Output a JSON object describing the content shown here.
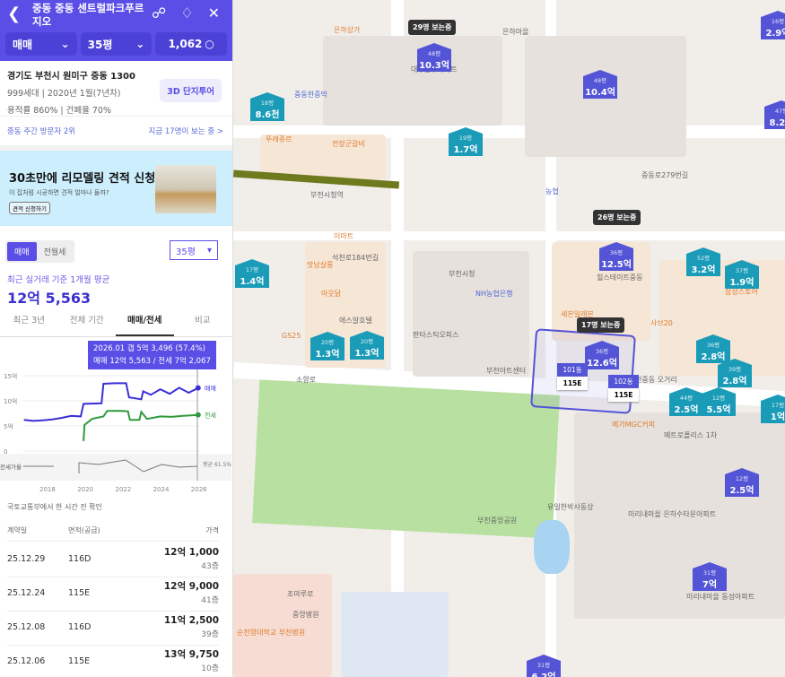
{
  "header": {
    "title": "중동 중동 센트럴파크푸르지오",
    "filters": [
      "매매",
      "35평",
      "1,062"
    ]
  },
  "info": {
    "address": "경기도 부천시 원미구 중동 1300",
    "line1": "999세대 | 2020년 1월(7년차)",
    "line2": "용적률 860% | 건폐율 70%",
    "tour": "3D 단지투어"
  },
  "visit": {
    "rank": "중동 주간 방문자 2위",
    "now": "지금 17명이 보는 중 >"
  },
  "ad": {
    "title": "30초만에 리모델링 견적 신청",
    "sub": "이 집처럼 시공하면 견적 얼마나 들까?",
    "button": "견적 신청하기"
  },
  "price": {
    "toggle": [
      "매매",
      "전월세"
    ],
    "size": "35평",
    "avg_label": "최근 실거래 기준 1개월 평균",
    "avg": "12억 5,563",
    "tabs": [
      "최근 3년",
      "전체 기간",
      "매매/전세",
      "비교"
    ],
    "tooltip1": "2026.01  갭 5억 3,496 (57.4%)",
    "tooltip2": "매매 12억 5,563 / 전세 7억 2,067"
  },
  "chart_data": {
    "type": "line",
    "xlim": [
      2016.8,
      2026.3
    ],
    "ylim": [
      0,
      15
    ],
    "yticks": [
      "15억",
      "10억",
      "5억",
      "0"
    ],
    "yvals": [
      15,
      10,
      5,
      0
    ],
    "xticks": [
      "2018",
      "2020",
      "2022",
      "2024",
      "2026"
    ],
    "xvals": [
      2018,
      2020,
      2022,
      2024,
      2026
    ],
    "series": [
      {
        "name": "매매",
        "color": "#3b2fd6",
        "x": [
          2016.8,
          2017.3,
          2017.8,
          2018.3,
          2018.8,
          2019.3,
          2019.8,
          2019.95,
          2020.9,
          2021.0,
          2021.6,
          2022.2,
          2022.35,
          2023.0,
          2023.1,
          2023.5,
          2024.0,
          2024.5,
          2025.0,
          2025.5,
          2026.0
        ],
        "y": [
          6.2,
          6.0,
          6.1,
          6.3,
          6.6,
          7.0,
          6.9,
          9.4,
          9.5,
          13.4,
          13.5,
          13.5,
          10.7,
          10.3,
          11.9,
          11.2,
          12.3,
          11.4,
          12.6,
          11.6,
          12.56
        ]
      },
      {
        "name": "전세",
        "color": "#2e9a3c",
        "x": [
          2019.95,
          2020.0,
          2020.4,
          2021.0,
          2021.2,
          2022.0,
          2022.3,
          2022.4,
          2022.9,
          2023.0,
          2023.3,
          2024.0,
          2024.6,
          2025.2,
          2026.0
        ],
        "y": [
          2.0,
          5.2,
          6.4,
          6.9,
          8.0,
          8.0,
          7.9,
          6.2,
          6.2,
          7.8,
          6.4,
          6.9,
          6.8,
          7.0,
          7.2
        ]
      }
    ],
    "series_labels": [
      "매매",
      "전세"
    ],
    "gap_label": "전세가율",
    "gap_avg": "평균 61.5%"
  },
  "trades": {
    "source": "국토교통부에서 한 시간 전 확인",
    "headers": [
      "계약일",
      "면적(공급)",
      "가격"
    ],
    "rows": [
      {
        "date": "25.12.29",
        "area": "116D",
        "price": "12억 1,000",
        "floor": "43층"
      },
      {
        "date": "25.12.24",
        "area": "115E",
        "price": "12억 9,000",
        "floor": "41층"
      },
      {
        "date": "25.12.08",
        "area": "116D",
        "price": "11억 2,500",
        "floor": "39층"
      },
      {
        "date": "25.12.06",
        "area": "115E",
        "price": "13억 9,750",
        "floor": "10층"
      }
    ]
  },
  "map": {
    "viewers": [
      "29명 보는중",
      "26명 보는중",
      "17명 보는중"
    ],
    "markers": [
      {
        "area": "48평",
        "price": "10.3억"
      },
      {
        "area": "48평",
        "price": "10.4억"
      },
      {
        "area": "16평",
        "price": "2.9억"
      },
      {
        "area": "47평",
        "price": "8.2억"
      },
      {
        "area": "36평",
        "price": "12.5억"
      },
      {
        "area": "36평",
        "price": "12.6억"
      },
      {
        "area": "12평",
        "price": "2.5억"
      },
      {
        "area": "31평",
        "price": "7억"
      },
      {
        "area": "31평",
        "price": "6.2억"
      },
      {
        "area": "18평",
        "price": "8.6천"
      },
      {
        "area": "19평",
        "price": "1.7억"
      },
      {
        "area": "17평",
        "price": "1.4억"
      },
      {
        "area": "52평",
        "price": "3.2억"
      },
      {
        "area": "37평",
        "price": "1.9억"
      },
      {
        "area": "20평",
        "price": "1.3억"
      },
      {
        "area": "20평",
        "price": "1.3억"
      },
      {
        "area": "36평",
        "price": "2.8억"
      },
      {
        "area": "39평",
        "price": "2.8억"
      },
      {
        "area": "44평",
        "price": "2.5억"
      },
      {
        "area": "12평",
        "price": "5.5억"
      },
      {
        "area": "17평",
        "price": "1억"
      }
    ],
    "dongs": [
      {
        "name": "101동",
        "type": "115E"
      },
      {
        "name": "102동",
        "type": "115E"
      }
    ],
    "places": [
      "은하마을",
      "은하상가",
      "대우동부아파트",
      "중동한증막",
      "전장군갈비",
      "부천시청역",
      "이마트",
      "부천시청",
      "NH농협은행",
      "판타스틱오피스",
      "부천아트센터",
      "힐스테이트중동",
      "세븐일레븐",
      "부천중앙공원",
      "유일한박사동상",
      "순천향대학교 부천병원",
      "미리내마을 동성아파트",
      "미리내마을 은하수타운아파트",
      "천중동 오거리",
      "메가MGC커피",
      "뚜레쥬르",
      "GS25",
      "맛남살롱",
      "아웃닭",
      "에스알호텔",
      "삼성스토어",
      "사브20",
      "중앙병원",
      "조마루로",
      "소향로",
      "석천로184번길",
      "중동로279번길",
      "농협",
      "메트로폴리스 1차"
    ]
  }
}
